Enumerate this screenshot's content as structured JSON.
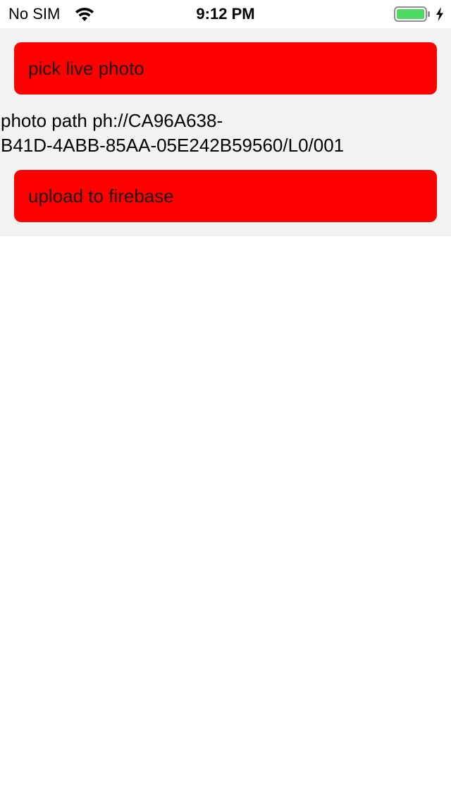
{
  "status_bar": {
    "carrier": "No SIM",
    "time": "9:12 PM",
    "wifi_icon": "wifi-icon",
    "battery_icon": "battery-icon",
    "charging_icon": "bolt-icon",
    "battery_color": "#4cd964"
  },
  "main": {
    "pick_button_label": "pick live photo",
    "photo_path_line1": "photo path ph://CA96A638-",
    "photo_path_line2": "B41D-4ABB-85AA-05E242B59560/L0/001",
    "upload_button_label": "upload to firebase",
    "button_color": "#ff0000",
    "panel_color": "#f2f2f2"
  }
}
